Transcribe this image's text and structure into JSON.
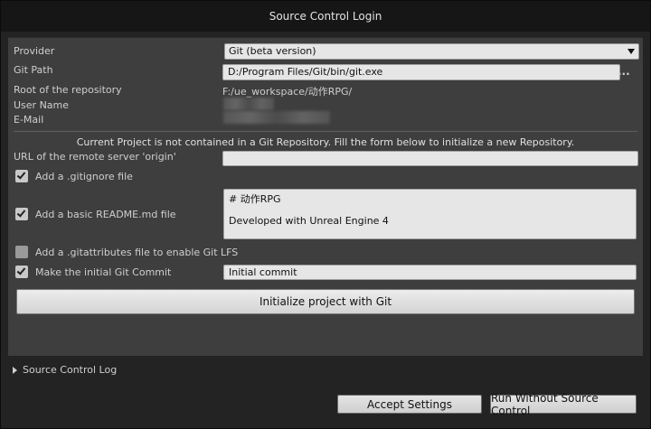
{
  "window": {
    "title": "Source Control Login"
  },
  "form": {
    "provider_label": "Provider",
    "provider_value": "Git  (beta version)",
    "git_path_label": "Git Path",
    "git_path_value": "D:/Program Files/Git/bin/git.exe",
    "browse_label": "...",
    "root_label": "Root of the repository",
    "root_value": "F:/ue_workspace/动作RPG/",
    "user_name_label": "User Name",
    "email_label": "E-Mail"
  },
  "notice": "Current Project is not contained in a Git Repository. Fill the form below to initialize a new Repository.",
  "init": {
    "url_label": "URL of the remote server 'origin'",
    "url_value": "",
    "gitignore_label": "Add a .gitignore file",
    "gitignore_checked": true,
    "readme_label": "Add a basic README.md file",
    "readme_checked": true,
    "readme_line1": "# 动作RPG",
    "readme_line2": "Developed with Unreal Engine 4",
    "gitattributes_label": "Add a .gitattributes file to enable Git LFS",
    "gitattributes_checked": false,
    "commit_label": "Make the initial Git Commit",
    "commit_checked": true,
    "commit_message": "Initial commit",
    "init_button": "Initialize project with Git"
  },
  "log": {
    "label": "Source Control Log"
  },
  "footer": {
    "accept_button": "Accept Settings",
    "run_without_button": "Run Without Source Control"
  },
  "colors": {
    "background": "#232323",
    "panel": "#3e3e3e",
    "field": "#e6e6e6",
    "titlebar": "#161616"
  }
}
